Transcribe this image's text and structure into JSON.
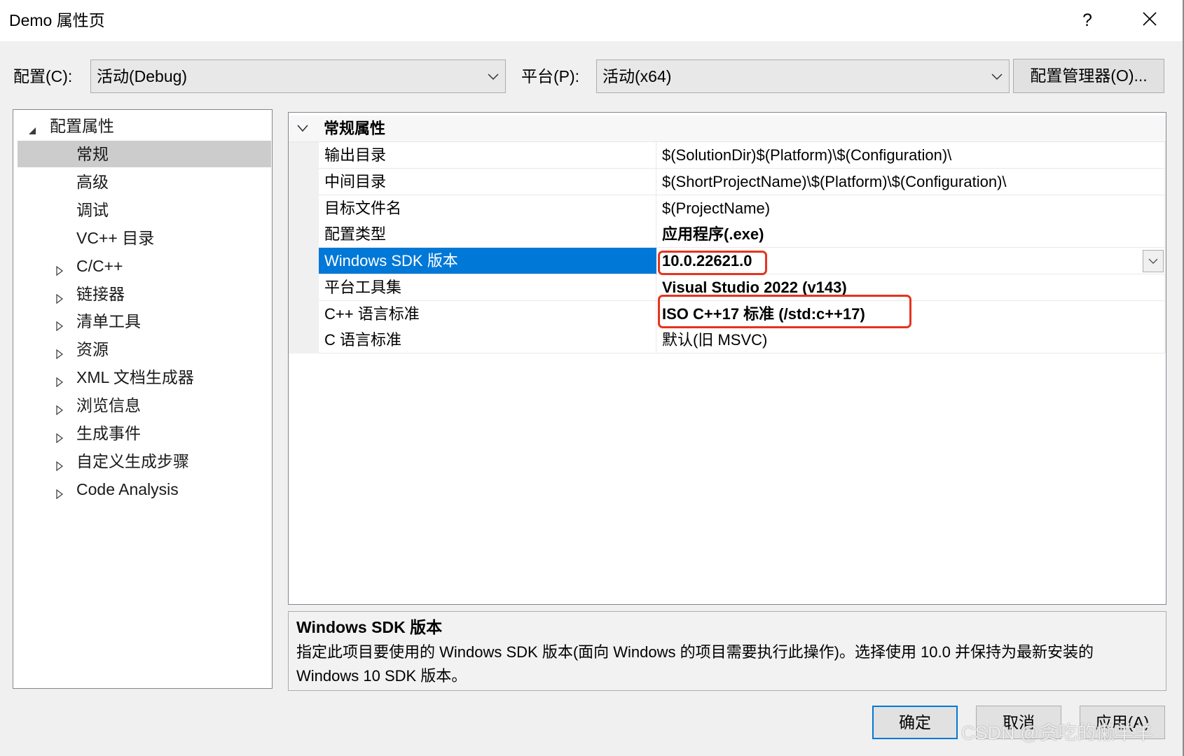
{
  "window": {
    "title": "Demo 属性页",
    "help_label": "?"
  },
  "toolbar": {
    "config_label": "配置(C):",
    "config_value": "活动(Debug)",
    "platform_label": "平台(P):",
    "platform_value": "活动(x64)",
    "config_manager_label": "配置管理器(O)..."
  },
  "tree": {
    "root": {
      "label": "配置属性",
      "expanded": true
    },
    "items": [
      {
        "label": "常规",
        "selected": true,
        "has_children": false
      },
      {
        "label": "高级",
        "selected": false,
        "has_children": false
      },
      {
        "label": "调试",
        "selected": false,
        "has_children": false
      },
      {
        "label": "VC++ 目录",
        "selected": false,
        "has_children": false
      },
      {
        "label": "C/C++",
        "selected": false,
        "has_children": true
      },
      {
        "label": "链接器",
        "selected": false,
        "has_children": true
      },
      {
        "label": "清单工具",
        "selected": false,
        "has_children": true
      },
      {
        "label": "资源",
        "selected": false,
        "has_children": true
      },
      {
        "label": "XML 文档生成器",
        "selected": false,
        "has_children": true
      },
      {
        "label": "浏览信息",
        "selected": false,
        "has_children": true
      },
      {
        "label": "生成事件",
        "selected": false,
        "has_children": true
      },
      {
        "label": "自定义生成步骤",
        "selected": false,
        "has_children": true
      },
      {
        "label": "Code Analysis",
        "selected": false,
        "has_children": true
      }
    ]
  },
  "grid": {
    "category": {
      "label": "常规属性",
      "expanded": true
    },
    "rows": [
      {
        "name": "输出目录",
        "value": "$(SolutionDir)$(Platform)\\$(Configuration)\\",
        "modified": false,
        "selected": false,
        "annotated": false
      },
      {
        "name": "中间目录",
        "value": "$(ShortProjectName)\\$(Platform)\\$(Configuration)\\",
        "modified": false,
        "selected": false,
        "annotated": false
      },
      {
        "name": "目标文件名",
        "value": "$(ProjectName)",
        "modified": false,
        "selected": false,
        "annotated": false
      },
      {
        "name": "配置类型",
        "value": "应用程序(.exe)",
        "modified": true,
        "selected": false,
        "annotated": false
      },
      {
        "name": "Windows SDK 版本",
        "value": "10.0.22621.0",
        "modified": true,
        "selected": true,
        "annotated": true
      },
      {
        "name": "平台工具集",
        "value": "Visual Studio 2022 (v143)",
        "modified": true,
        "selected": false,
        "annotated": false
      },
      {
        "name": "C++ 语言标准",
        "value": "ISO C++17 标准 (/std:c++17)",
        "modified": true,
        "selected": false,
        "annotated": true
      },
      {
        "name": "C 语言标准",
        "value": "默认(旧 MSVC)",
        "modified": false,
        "selected": false,
        "annotated": false
      }
    ]
  },
  "description": {
    "title": "Windows SDK 版本",
    "text": "指定此项目要使用的 Windows SDK 版本(面向 Windows 的项目需要执行此操作)。选择使用 10.0 并保持为最新安装的 Windows 10 SDK 版本。"
  },
  "buttons": {
    "ok_label": "确定",
    "cancel_label": "取消",
    "apply_label": "应用(A)",
    "default": "ok"
  },
  "watermark": "CSDN @贪吃的懒羊羊",
  "icons": {
    "help": "question-icon",
    "close": "close-icon",
    "combo_arrow": "chevron-down-icon",
    "tree_expanded": "triangle-down-icon",
    "tree_collapsed": "triangle-right-icon",
    "category_toggle": "chevron-down-icon",
    "property_dropdown": "chevron-down-icon"
  },
  "colors": {
    "selection": "#0078D7",
    "annotation": "#E5341F",
    "tree_selection": "#CCCCCC",
    "default_button_border": "#0078D7"
  }
}
